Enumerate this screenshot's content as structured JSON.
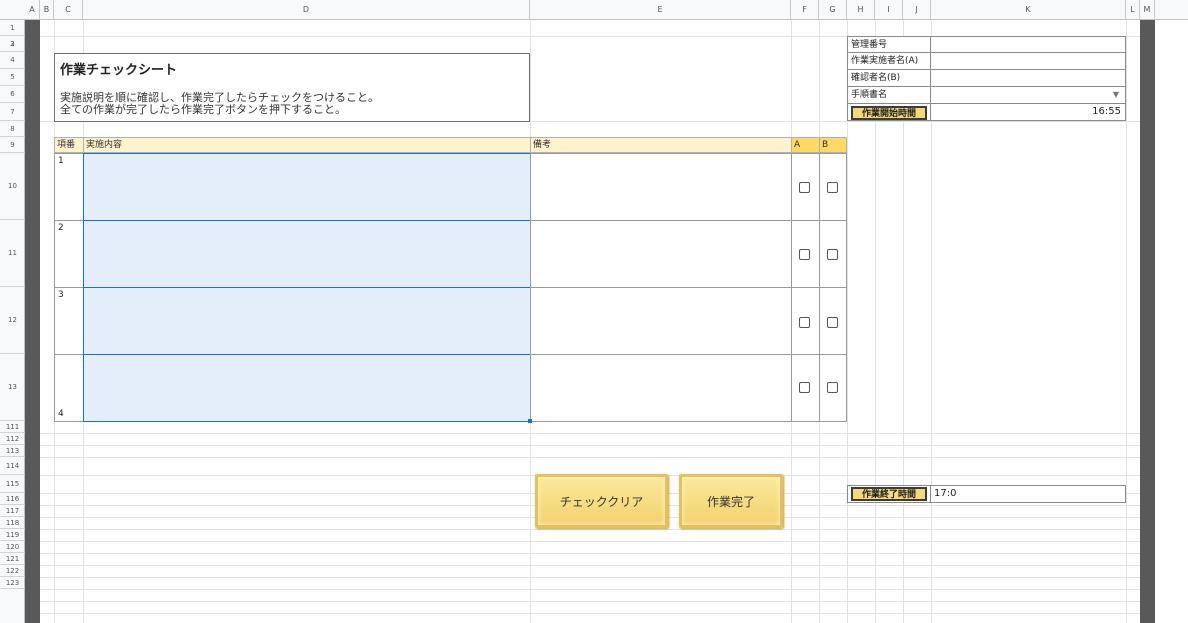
{
  "columns": [
    "A",
    "B",
    "C",
    "D",
    "E",
    "F",
    "G",
    "H",
    "I",
    "J",
    "K",
    "L",
    "M"
  ],
  "rows": [
    "1",
    "2",
    "3",
    "4",
    "5",
    "6",
    "7",
    "8",
    "9",
    "10",
    "11",
    "12",
    "13",
    "111",
    "112",
    "113",
    "114",
    "115",
    "116",
    "117",
    "118",
    "119",
    "120",
    "121",
    "122",
    "123"
  ],
  "sheet": {
    "title": "作業チェックシート",
    "desc1": "実施説明を順に確認し、作業完了したらチェックをつけること。",
    "desc2": "全ての作業が完了したら作業完了ボタンを押下すること。"
  },
  "info": {
    "mgmt_no": "管理番号",
    "worker_a": "作業実施者名(A)",
    "checker_b": "確認者名(B)",
    "manual": "手順書名",
    "start_label": "作業開始時間",
    "start_value": "16:55",
    "end_label": "作業終了時間",
    "end_value": "17:0"
  },
  "table": {
    "headers": {
      "no": "項番",
      "content": "実施内容",
      "note": "備考",
      "a": "A",
      "b": "B"
    },
    "items": [
      {
        "no": "1"
      },
      {
        "no": "2"
      },
      {
        "no": "3"
      },
      {
        "no": "4"
      }
    ]
  },
  "buttons": {
    "clear": "チェッククリア",
    "complete": "作業完了"
  }
}
